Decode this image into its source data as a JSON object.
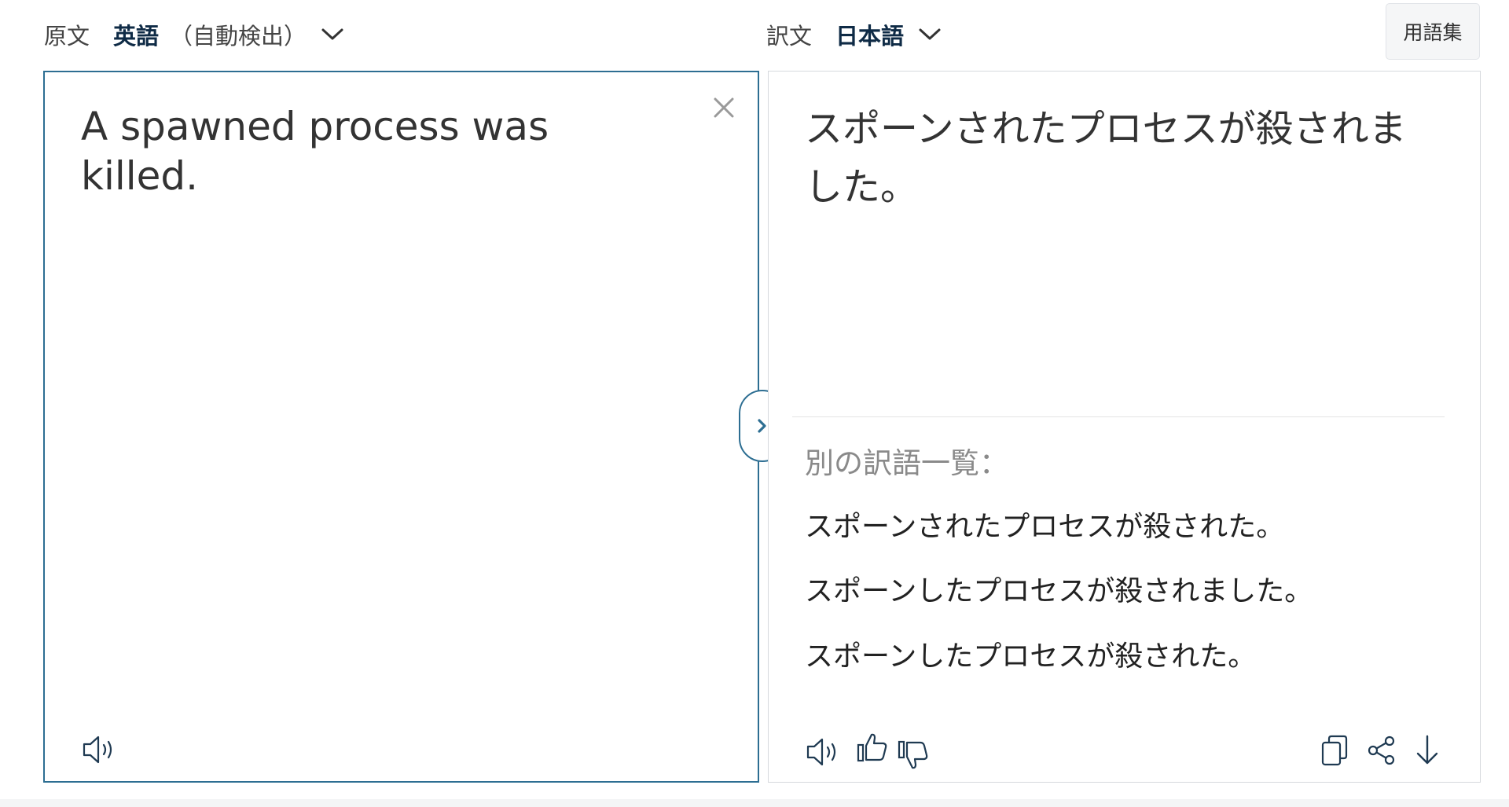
{
  "source": {
    "caption": "原文",
    "language": "英語",
    "detect_note": "（自動検出）",
    "text": "A spawned process was killed."
  },
  "target": {
    "caption": "訳文",
    "language": "日本語",
    "text": "スポーンされたプロセスが殺されました。"
  },
  "glossary_label": "用語集",
  "alternatives": {
    "heading": "別の訳語一覧：",
    "items": [
      "スポーンされたプロセスが殺された。",
      "スポーンしたプロセスが殺されました。",
      "スポーンしたプロセスが殺された。"
    ]
  },
  "icons": {
    "source_speaker": "speaker-icon",
    "clear": "close-icon",
    "swap": "chevron-right-icon",
    "target_speaker": "speaker-icon",
    "like": "thumbs-up-icon",
    "dislike": "thumbs-down-icon",
    "copy": "copy-icon",
    "share": "share-icon",
    "download": "download-icon"
  },
  "colors": {
    "accent": "#2d6e92",
    "language_text": "#0f2b46",
    "muted_text": "#8a8a8a"
  }
}
